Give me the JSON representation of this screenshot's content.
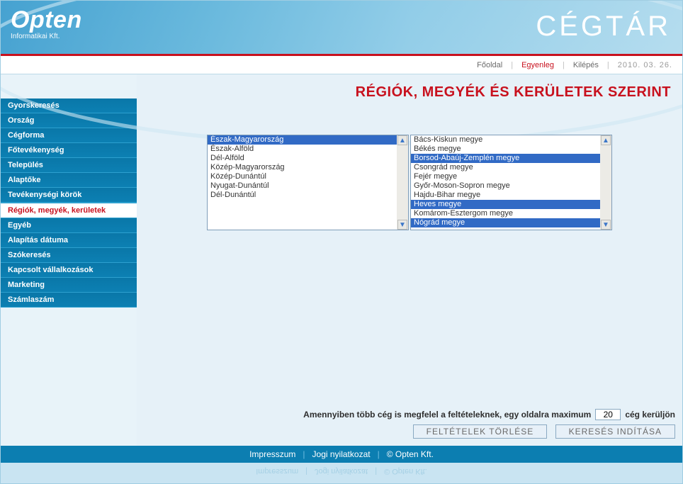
{
  "brand": {
    "name": "Opten",
    "subtitle": "Informatikai Kft."
  },
  "app_title": "CÉGTÁR",
  "topnav": {
    "home": "Főoldal",
    "balance": "Egyenleg",
    "logout": "Kilépés",
    "date": "2010. 03. 26."
  },
  "sidebar": {
    "items": [
      "Gyorskeresés",
      "Ország",
      "Cégforma",
      "Főtevékenység",
      "Település",
      "Alaptőke",
      "Tevékenységi körök",
      "Régiók, megyék, kerületek",
      "Egyéb",
      "Alapítás dátuma",
      "Szókeresés",
      "Kapcsolt vállalkozások",
      "Marketing",
      "Számlaszám"
    ],
    "active_index": 7
  },
  "page_title": "RÉGIÓK, MEGYÉK ÉS KERÜLETEK SZERINT",
  "regions": {
    "items": [
      "Észak-Magyarország",
      "Észak-Alföld",
      "Dél-Alföld",
      "Közép-Magyarország",
      "Közép-Dunántúl",
      "Nyugat-Dunántúl",
      "Dél-Dunántúl"
    ],
    "selected_indices": [
      0
    ]
  },
  "counties": {
    "items": [
      "Bács-Kiskun megye",
      "Békés megye",
      "Borsod-Abaúj-Zemplén megye",
      "Csongrád megye",
      "Fejér megye",
      "Győr-Moson-Sopron megye",
      "Hajdu-Bihar megye",
      "Heves megye",
      "Komárom-Esztergom megye",
      "Nógrád megye"
    ],
    "selected_indices": [
      2,
      7,
      9
    ]
  },
  "pager": {
    "prefix": "Amennyiben több cég is megfelel a feltételeknek, egy oldalra maximum",
    "value": "20",
    "suffix": "cég kerüljön"
  },
  "buttons": {
    "clear": "FELTÉTELEK TÖRLÉSE",
    "search": "KERESÉS INDÍTÁSA"
  },
  "footer": {
    "impressum": "Impresszum",
    "legal": "Jogi nyilatkozat",
    "copyright": "© Opten Kft."
  }
}
